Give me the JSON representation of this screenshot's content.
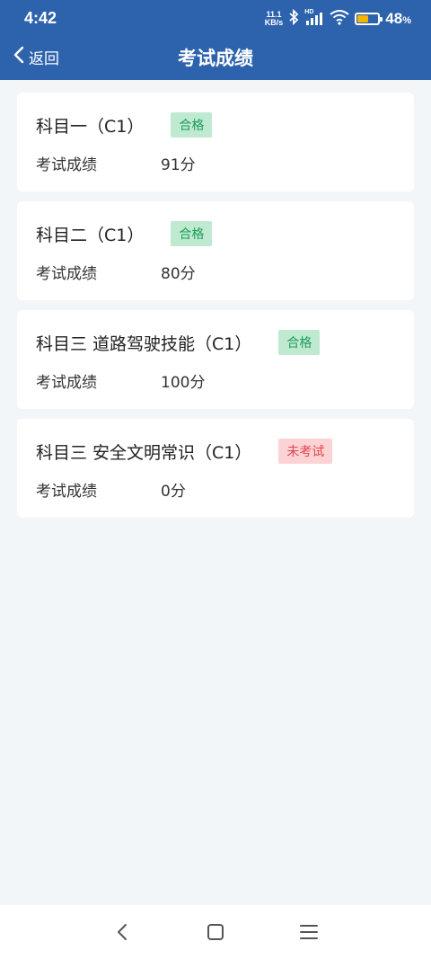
{
  "status_bar": {
    "time": "4:42",
    "net_speed_top": "11.1",
    "net_speed_bottom": "KB/s",
    "hd_label": "HD",
    "battery_percent": "48",
    "battery_percent_sign": "%",
    "battery_level": 0.48,
    "battery_color": "#f4b400"
  },
  "header": {
    "back_label": "返回",
    "title": "考试成绩",
    "background": "#2d63ad"
  },
  "results": [
    {
      "subject": "科目一（C1）",
      "status": "合格",
      "status_type": "pass",
      "score_label": "考试成绩",
      "score": "91分"
    },
    {
      "subject": "科目二（C1）",
      "status": "合格",
      "status_type": "pass",
      "score_label": "考试成绩",
      "score": "80分"
    },
    {
      "subject": "科目三 道路驾驶技能（C1）",
      "status": "合格",
      "status_type": "pass",
      "score_label": "考试成绩",
      "score": "100分"
    },
    {
      "subject": "科目三 安全文明常识（C1）",
      "status": "未考试",
      "status_type": "fail",
      "score_label": "考试成绩",
      "score": "0分"
    }
  ],
  "nav": {
    "icons": [
      "back-icon",
      "home-icon",
      "menu-icon"
    ]
  }
}
